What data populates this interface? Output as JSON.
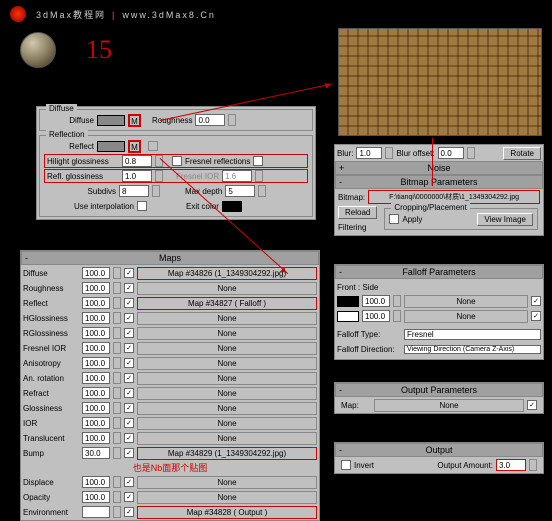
{
  "header": {
    "site": "3dMax教程网",
    "url": "www.3dMax8.Cn"
  },
  "step_num": "15",
  "diffuse_grp": {
    "title": "Diffuse",
    "diffuse_lbl": "Diffuse",
    "roughness_lbl": "Roughness",
    "roughness_val": "0.0"
  },
  "reflection_grp": {
    "title": "Reflection",
    "reflect_lbl": "Reflect",
    "hilight_lbl": "Hilight glossiness",
    "hilight_val": "0.8",
    "refl_gloss_lbl": "Refl. glossiness",
    "refl_gloss_val": "1.0",
    "subdivs_lbl": "Subdivs",
    "subdivs_val": "8",
    "interp_lbl": "Use interpolation",
    "fresnel_lbl": "Fresnel reflections",
    "fresnel_ior_lbl": "Fresnel IOR",
    "fresnel_ior_val": "1.6",
    "maxdepth_lbl": "Max depth",
    "maxdepth_val": "5",
    "exit_lbl": "Exit color"
  },
  "maps_hdr": "Maps",
  "maps": [
    {
      "name": "Diffuse",
      "amt": "100.0",
      "slot": "Map #34826  (1_1349304292.jpg)",
      "red": true
    },
    {
      "name": "Roughness",
      "amt": "100.0",
      "slot": "None"
    },
    {
      "name": "Reflect",
      "amt": "100.0",
      "slot": "Map #34827   ( Falloff )",
      "red": true
    },
    {
      "name": "HGlossiness",
      "amt": "100.0",
      "slot": "None"
    },
    {
      "name": "RGlossiness",
      "amt": "100.0",
      "slot": "None"
    },
    {
      "name": "Fresnel IOR",
      "amt": "100.0",
      "slot": "None"
    },
    {
      "name": "Anisotropy",
      "amt": "100.0",
      "slot": "None"
    },
    {
      "name": "An. rotation",
      "amt": "100.0",
      "slot": "None"
    },
    {
      "name": "Refract",
      "amt": "100.0",
      "slot": "None"
    },
    {
      "name": "Glossiness",
      "amt": "100.0",
      "slot": "None"
    },
    {
      "name": "IOR",
      "amt": "100.0",
      "slot": "None"
    },
    {
      "name": "Translucent",
      "amt": "100.0",
      "slot": "None"
    },
    {
      "name": "Bump",
      "amt": "30.0",
      "slot": "Map #34829  (1_1349304292.jpg)",
      "red": true,
      "note": "也是Nb面那个贴图"
    },
    {
      "name": "Displace",
      "amt": "100.0",
      "slot": "None"
    },
    {
      "name": "Opacity",
      "amt": "100.0",
      "slot": "None"
    },
    {
      "name": "Environment",
      "amt": "",
      "slot": "Map #34828   ( Output )",
      "red": true
    }
  ],
  "blur_panel": {
    "blur_lbl": "Blur:",
    "blur_val": "1.0",
    "offset_lbl": "Blur offset:",
    "offset_val": "0.0",
    "rotate": "Rotate"
  },
  "noise_hdr": "Noise",
  "bitmap_hdr": "Bitmap Parameters",
  "bitmap": {
    "lbl": "Bitmap:",
    "path": "F:\\tianqi\\0000000\\材质\\1_1349304292.jpg",
    "reload": "Reload",
    "crop_title": "Cropping/Placement",
    "apply": "Apply",
    "view": "View Image",
    "filtering": "Filtering"
  },
  "falloff_hdr": "Falloff Parameters",
  "falloff": {
    "front_side": "Front : Side",
    "amt1": "100.0",
    "slot1": "None",
    "amt2": "100.0",
    "slot2": "None",
    "type_lbl": "Falloff Type:",
    "type_val": "Fresnel",
    "dir_lbl": "Falloff Direction:",
    "dir_val": "Viewing Direction (Camera Z-Axis)"
  },
  "output_params_hdr": "Output Parameters",
  "output_params": {
    "map_lbl": "Map:",
    "map_slot": "None"
  },
  "output_hdr": "Output",
  "output": {
    "invert": "Invert",
    "amount_lbl": "Output Amount:",
    "amount_val": "3.0"
  }
}
